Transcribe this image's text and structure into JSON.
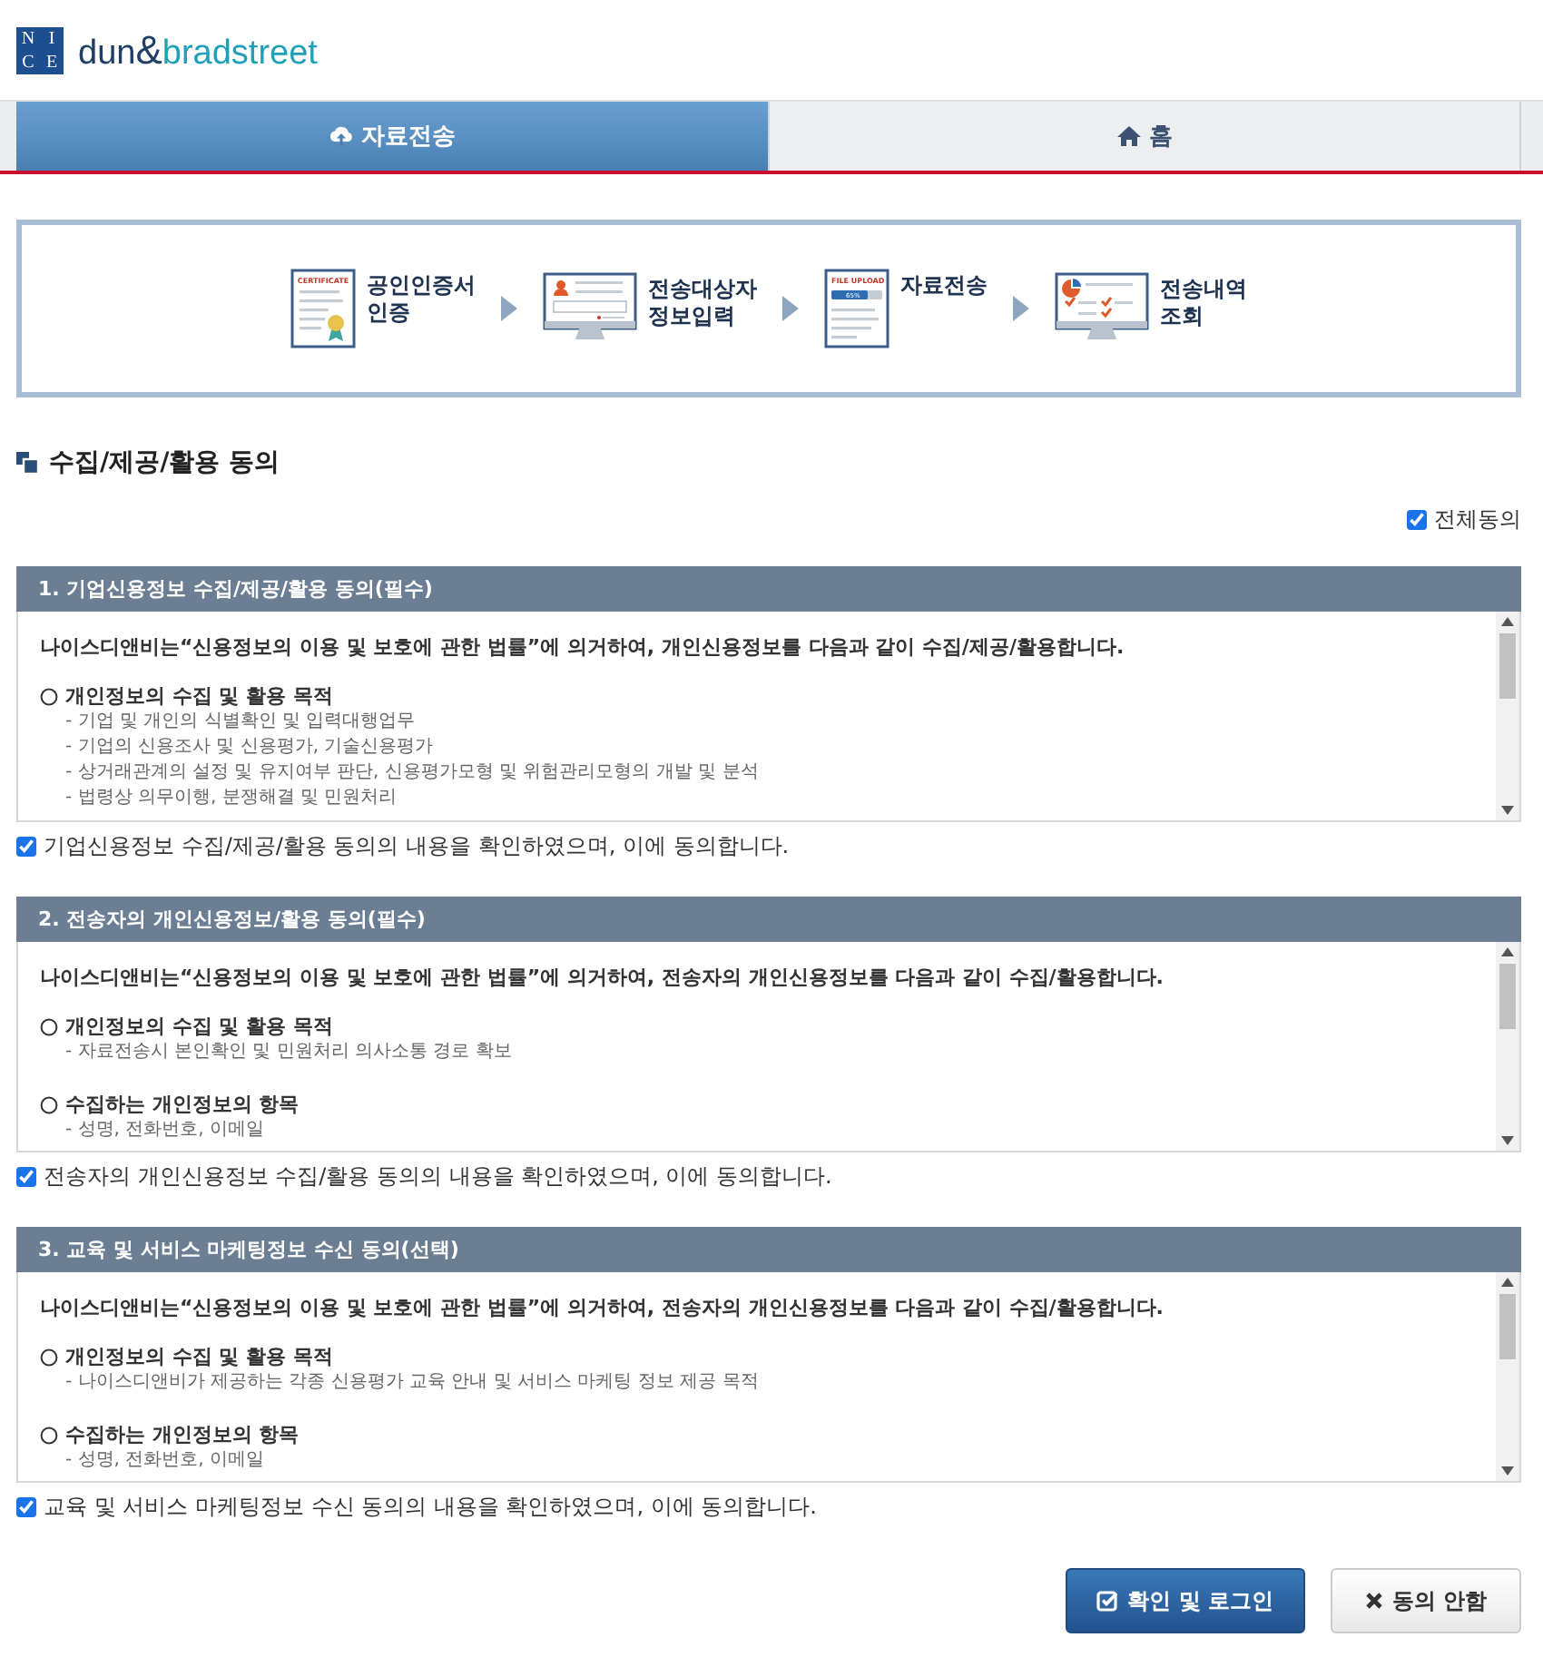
{
  "logo": {
    "mark_letters": [
      "N",
      "I",
      "C",
      "E"
    ],
    "wordmark": [
      "dun",
      "&",
      "bradstreet"
    ]
  },
  "tabs": [
    {
      "label": "자료전송",
      "selected": true
    },
    {
      "label": "홈",
      "selected": false
    }
  ],
  "steps": [
    {
      "kind": "certificate",
      "icon_text": "CERTIFICATE",
      "label": [
        "공인인증서",
        "인증"
      ]
    },
    {
      "kind": "monitor-form",
      "label": [
        "전송대상자",
        "정보입력"
      ]
    },
    {
      "kind": "file-upload",
      "icon_text": "FILE UPLOAD",
      "progress_text": "65%",
      "label": [
        "자료전송"
      ]
    },
    {
      "kind": "monitor-chart",
      "label": [
        "전송내역",
        "조회"
      ]
    }
  ],
  "page_title": "수집/제공/활용 동의",
  "agree_all": {
    "label": "전체동의",
    "checked": true
  },
  "sections": [
    {
      "title": "1. 기업신용정보 수집/제공/활용 동의(필수)",
      "intro": "나이스디앤비는“신용정보의 이용 및 보호에 관한 법률”에 의거하여, 개인신용정보를 다음과 같이 수집/제공/활용합니다.",
      "items": [
        {
          "heading": "개인정보의 수집 및 활용 목적",
          "lines": [
            "- 기업 및 개인의 식별확인 및 입력대행업무",
            "- 기업의 신용조사 및 신용평가, 기술신용평가",
            "- 상거래관계의 설정 및 유지여부 판단, 신용평가모형 및 위험관리모형의 개발 및 분석",
            "- 법령상 의무이행, 분쟁해결 및 민원처리"
          ]
        }
      ],
      "consent": "기업신용정보 수집/제공/활용 동의의 내용을 확인하였으며, 이에 동의합니다.",
      "checked": true
    },
    {
      "title": "2. 전송자의 개인신용정보/활용 동의(필수)",
      "intro": "나이스디앤비는“신용정보의 이용 및 보호에 관한 법률”에 의거하여, 전송자의 개인신용정보를 다음과 같이 수집/활용합니다.",
      "items": [
        {
          "heading": "개인정보의 수집 및 활용 목적",
          "lines": [
            "- 자료전송시 본인확인 및 민원처리 의사소통 경로 확보"
          ]
        },
        {
          "heading": "수집하는 개인정보의 항목",
          "lines": [
            "- 성명, 전화번호, 이메일"
          ]
        }
      ],
      "consent": "전송자의 개인신용정보 수집/활용 동의의 내용을 확인하였으며, 이에 동의합니다.",
      "checked": true
    },
    {
      "title": "3. 교육 및 서비스 마케팅정보 수신 동의(선택)",
      "intro": "나이스디앤비는“신용정보의 이용 및 보호에 관한 법률”에 의거하여, 전송자의 개인신용정보를 다음과 같이 수집/활용합니다.",
      "items": [
        {
          "heading": "개인정보의 수집 및 활용 목적",
          "lines": [
            "- 나이스디앤비가 제공하는 각종 신용평가 교육 안내 및 서비스 마케팅 정보 제공 목적"
          ]
        },
        {
          "heading": "수집하는 개인정보의 항목",
          "lines": [
            "- 성명, 전화번호, 이메일"
          ]
        }
      ],
      "consent": "교육 및 서비스 마케팅정보 수신 동의의 내용을 확인하였으며, 이에 동의합니다.",
      "checked": true
    }
  ],
  "buttons": [
    {
      "label": "확인 및 로그인",
      "kind": "primary"
    },
    {
      "label": "동의 안함",
      "kind": "secondary"
    }
  ]
}
